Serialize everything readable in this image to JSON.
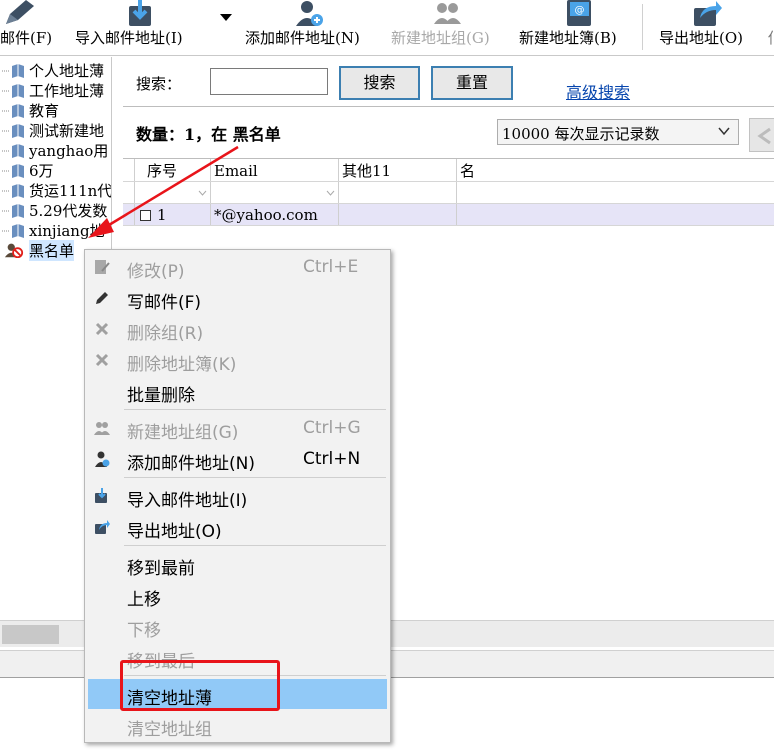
{
  "toolbar": {
    "items": [
      {
        "label": "邮件(F)",
        "icon": "pencil-icon",
        "disabled": false
      },
      {
        "label": "导入邮件地址(I)",
        "icon": "import-icon",
        "disabled": false
      },
      {
        "label": "添加邮件地址(N)",
        "icon": "add-user-icon",
        "disabled": false
      },
      {
        "label": "新建地址组(G)",
        "icon": "group-icon",
        "disabled": true
      },
      {
        "label": "新建地址簿(B)",
        "icon": "address-book-icon",
        "disabled": false
      },
      {
        "label": "导出地址(O)",
        "icon": "export-icon",
        "disabled": false
      },
      {
        "label": "佢",
        "icon": "",
        "disabled": false
      }
    ]
  },
  "tree": {
    "items": [
      {
        "label": "个人地址薄",
        "icon": "book-icon"
      },
      {
        "label": "工作地址薄",
        "icon": "book-icon"
      },
      {
        "label": "教育",
        "icon": "book-icon"
      },
      {
        "label": "测试新建地",
        "icon": "book-icon"
      },
      {
        "label": "yanghao用",
        "icon": "book-icon"
      },
      {
        "label": "6万",
        "icon": "book-icon"
      },
      {
        "label": "货运111n代",
        "icon": "book-icon"
      },
      {
        "label": "5.29代发数",
        "icon": "book-icon"
      },
      {
        "label": "xinjiang地",
        "icon": "book-icon"
      },
      {
        "label": "黑名单",
        "icon": "blacklist-icon",
        "selected": true
      }
    ]
  },
  "search": {
    "label": "搜索：",
    "value": "",
    "search_button": "搜索",
    "reset_button": "重置",
    "advanced_link": "高级搜索"
  },
  "count_text": "数量：1，在 黑名单",
  "page_size": {
    "selected": "10000 每次显示记录数"
  },
  "table": {
    "columns": [
      "序号",
      "Email",
      "其他11",
      "名"
    ],
    "rows": [
      {
        "index": "1",
        "email": "*@yahoo.com",
        "other": "",
        "name": ""
      }
    ]
  },
  "context_menu": {
    "items": [
      {
        "label": "修改(P)",
        "shortcut": "Ctrl+E",
        "disabled": true,
        "icon": "edit-icon"
      },
      {
        "label": "写邮件(F)",
        "shortcut": "",
        "disabled": false,
        "icon": "pencil-icon"
      },
      {
        "label": "删除组(R)",
        "shortcut": "",
        "disabled": true,
        "icon": "delete-icon"
      },
      {
        "label": "删除地址簿(K)",
        "shortcut": "",
        "disabled": true,
        "icon": "delete-icon"
      },
      {
        "label": "批量删除",
        "shortcut": "",
        "disabled": false,
        "icon": ""
      },
      {
        "label": "新建地址组(G)",
        "shortcut": "Ctrl+G",
        "disabled": true,
        "icon": "group-icon"
      },
      {
        "label": "添加邮件地址(N)",
        "shortcut": "Ctrl+N",
        "disabled": false,
        "icon": "add-user-icon"
      },
      {
        "label": "导入邮件地址(I)",
        "shortcut": "",
        "disabled": false,
        "icon": "import-icon"
      },
      {
        "label": "导出地址(O)",
        "shortcut": "",
        "disabled": false,
        "icon": "export-icon"
      },
      {
        "label": "移到最前",
        "shortcut": "",
        "disabled": false,
        "icon": ""
      },
      {
        "label": "上移",
        "shortcut": "",
        "disabled": false,
        "icon": ""
      },
      {
        "label": "下移",
        "shortcut": "",
        "disabled": true,
        "icon": ""
      },
      {
        "label": "移到最后",
        "shortcut": "",
        "disabled": true,
        "icon": ""
      },
      {
        "label": "清空地址薄",
        "shortcut": "",
        "disabled": false,
        "icon": "",
        "highlighted": true
      },
      {
        "label": "清空地址组",
        "shortcut": "",
        "disabled": true,
        "icon": ""
      }
    ]
  },
  "colors": {
    "highlight": "#91c9f7",
    "annotation": "#e8141a",
    "link": "#0645ad",
    "row_selected": "#e6e4f7",
    "button_border": "#3c7fb1"
  }
}
